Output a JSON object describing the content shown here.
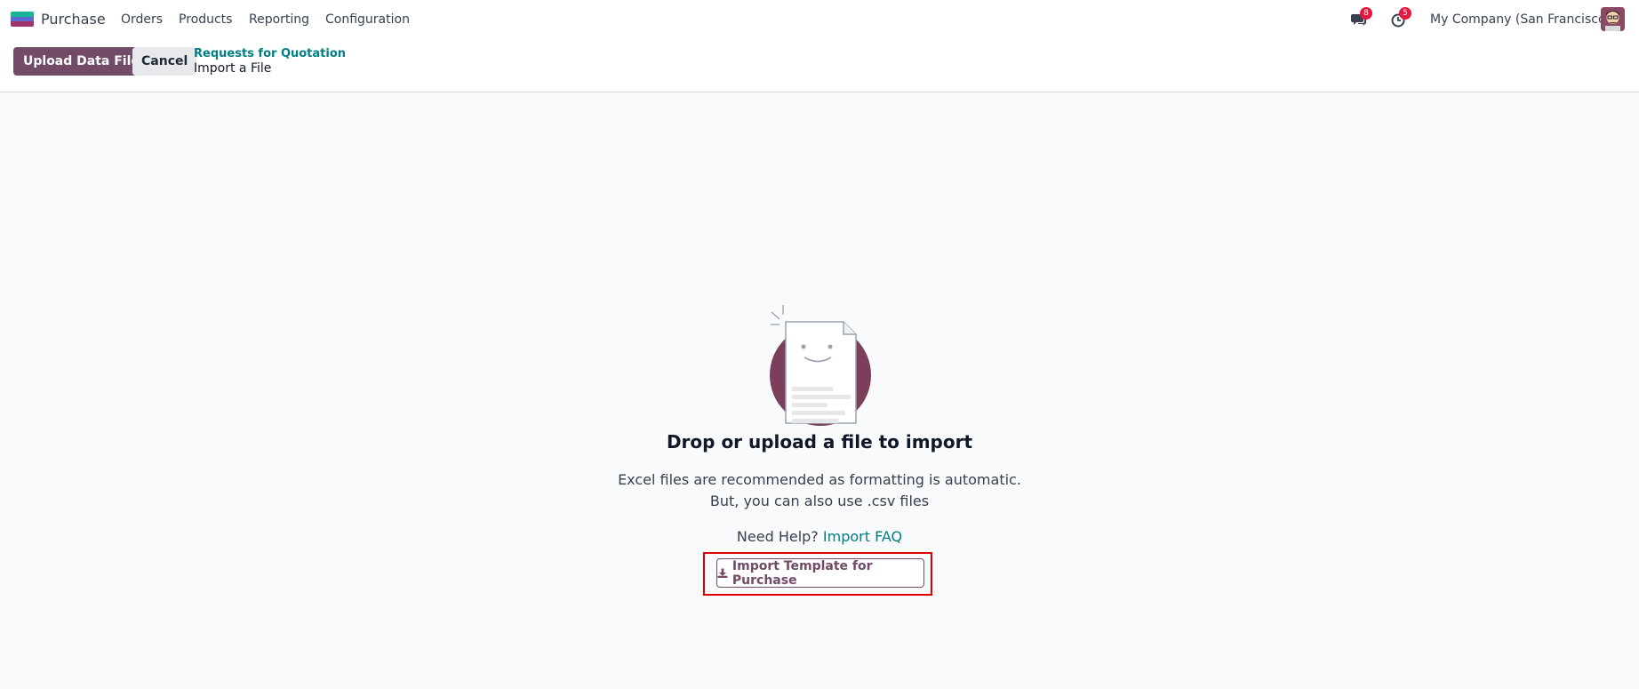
{
  "navbar": {
    "app_name": "Purchase",
    "menu": [
      "Orders",
      "Products",
      "Reporting",
      "Configuration"
    ],
    "messages_badge": "8",
    "activities_badge": "5",
    "company": "My Company (San Francisco)"
  },
  "control_panel": {
    "upload_label": "Upload Data File",
    "cancel_label": "Cancel",
    "breadcrumb_parent": "Requests for Quotation",
    "breadcrumb_current": "Import a File"
  },
  "main": {
    "title": "Drop or upload a file to import",
    "desc_line1": "Excel files are recommended as formatting is automatic.",
    "desc_line2": "But, you can also use .csv files",
    "help_prefix": "Need Help?",
    "help_link": "Import FAQ",
    "template_button": "Import Template for Purchase"
  },
  "colors": {
    "brand": "#714b67",
    "link": "#017e84",
    "highlight": "#e00000"
  }
}
